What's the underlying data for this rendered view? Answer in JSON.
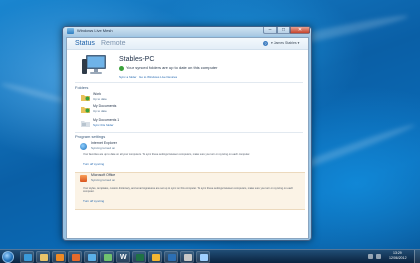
{
  "window": {
    "title": "Windows Live Mesh",
    "controls": {
      "minimize": "–",
      "maximize": "□",
      "close": "✕"
    }
  },
  "nav": {
    "tabs": [
      {
        "label": "Status",
        "active": true
      },
      {
        "label": "Remote",
        "active": false
      }
    ],
    "help": "?",
    "user": "▾  James Stables ▾"
  },
  "computer": {
    "name": "Stables-PC",
    "status": "Your synced folders are up to date on this computer",
    "links": [
      "Sync a folder",
      "Go to Windows Live Devices"
    ]
  },
  "sections": {
    "folders": "Folders",
    "program_settings": "Program settings"
  },
  "folders": [
    {
      "name": "Work",
      "status": "Up to date",
      "icon": "synced-folder-icon"
    },
    {
      "name": "My Documents",
      "status": "Up to date",
      "icon": "synced-folder-icon"
    },
    {
      "name": "My Documents 1",
      "status": "Sync this folder",
      "icon": "unsynced-folder-icon"
    }
  ],
  "programs": [
    {
      "name": "Internet Explorer",
      "status": "Syncing turned on",
      "description": "Your favorites are up to date on all your computers. To sync these settings between computers, make sure you turn on syncing on each computer.",
      "link": "Turn off syncing",
      "icon": "internet-explorer-icon"
    },
    {
      "name": "Microsoft Office",
      "status": "Syncing turned on",
      "description": "Your styles, templates, custom dictionary, and email signatures are set up to sync on this computer. To sync these settings between computers, make sure you turn on syncing on each computer.",
      "link": "Turn off syncing",
      "icon": "microsoft-office-icon"
    }
  ],
  "taskbar": {
    "apps": [
      {
        "name": "internet-explorer-icon",
        "color": "#3a9ad9"
      },
      {
        "name": "file-explorer-icon",
        "color": "#e9c46a"
      },
      {
        "name": "media-player-icon",
        "color": "#f08a24"
      },
      {
        "name": "firefox-icon",
        "color": "#e66a2c"
      },
      {
        "name": "live-mesh-icon",
        "color": "#5bb0e8"
      },
      {
        "name": "messenger-icon",
        "color": "#6fc16f"
      },
      {
        "name": "word-icon",
        "color": "#2b5797",
        "text": "W"
      },
      {
        "name": "excel-icon",
        "color": "#1e7145"
      },
      {
        "name": "outlook-icon",
        "color": "#f2b632"
      },
      {
        "name": "photoshop-icon",
        "color": "#2c6fb4"
      },
      {
        "name": "paint-icon",
        "color": "#c8c8c8"
      },
      {
        "name": "notepad-icon",
        "color": "#9fd0ff"
      }
    ],
    "clock": {
      "time": "13:29",
      "date": "12/06/2012"
    }
  }
}
